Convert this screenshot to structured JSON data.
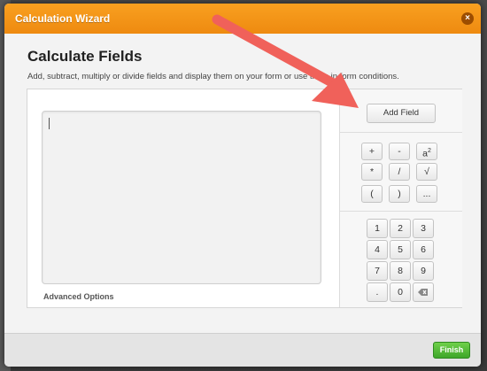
{
  "dialog": {
    "title": "Calculation Wizard",
    "close_icon": "close-icon",
    "heading": "Calculate Fields",
    "description": "Add, subtract, multiply or divide fields and display them on your form or use them in form conditions.",
    "advanced_options": "Advanced Options",
    "add_field": "Add Field",
    "operators": [
      "+",
      "-",
      "*",
      "/",
      "(",
      ")",
      "..."
    ],
    "power_label": "a",
    "power_sup": "2",
    "sqrt_label": "√",
    "keypad": [
      "1",
      "2",
      "3",
      "4",
      "5",
      "6",
      "7",
      "8",
      "9",
      ".",
      "0"
    ],
    "backspace_icon": "backspace-icon",
    "finish": "Finish"
  },
  "colors": {
    "titlebar": "#f39a1a",
    "finish": "#4fb836",
    "arrow": "#f0615a"
  }
}
